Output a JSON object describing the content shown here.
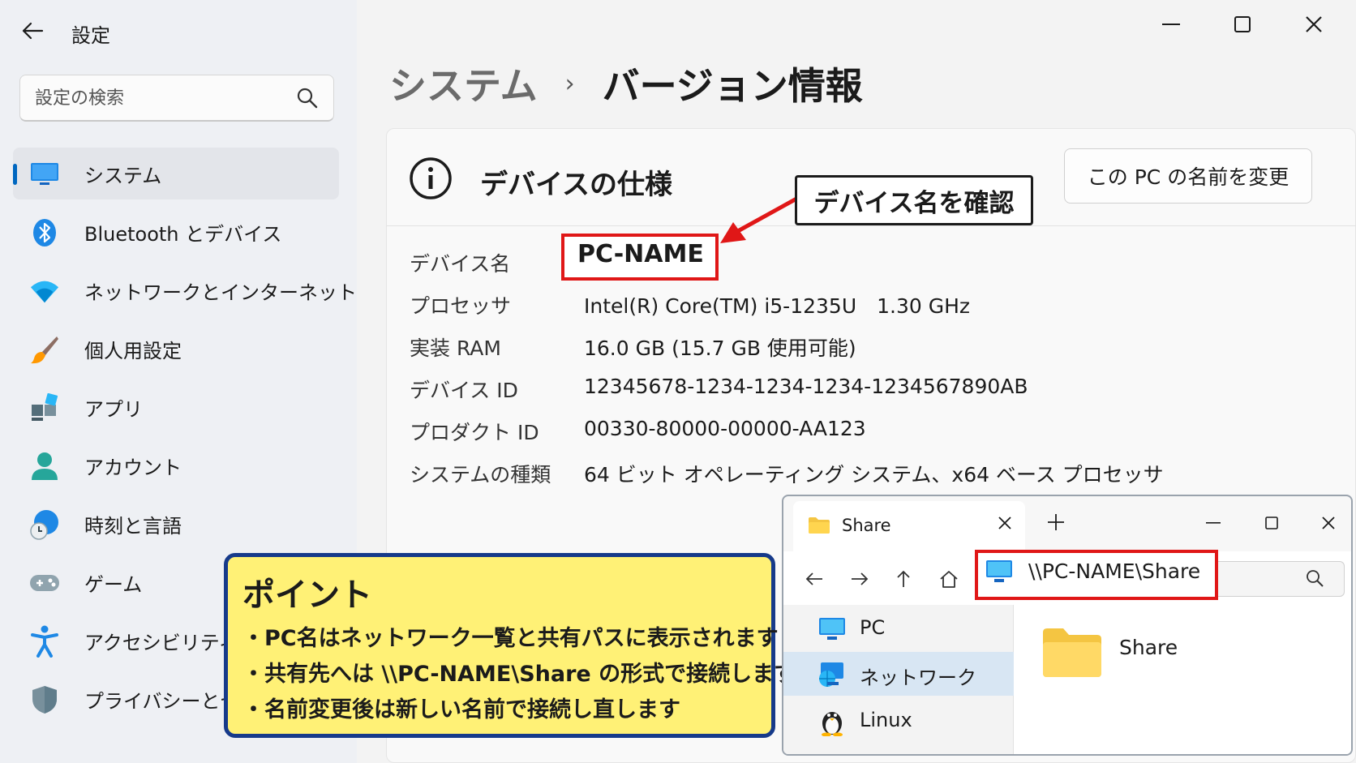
{
  "app": {
    "title": "設定"
  },
  "search": {
    "placeholder": "設定の検索"
  },
  "sidebar": {
    "items": [
      {
        "label": "システム",
        "icon": "monitor-icon",
        "selected": true
      },
      {
        "label": "Bluetooth とデバイス",
        "icon": "bluetooth-icon"
      },
      {
        "label": "ネットワークとインターネット",
        "icon": "wifi-icon"
      },
      {
        "label": "個人用設定",
        "icon": "paintbrush-icon"
      },
      {
        "label": "アプリ",
        "icon": "apps-icon"
      },
      {
        "label": "アカウント",
        "icon": "person-icon"
      },
      {
        "label": "時刻と言語",
        "icon": "globe-clock-icon"
      },
      {
        "label": "ゲーム",
        "icon": "gamepad-icon"
      },
      {
        "label": "アクセシビリティ",
        "icon": "accessibility-icon"
      },
      {
        "label": "プライバシーとセキ",
        "icon": "shield-icon"
      }
    ]
  },
  "breadcrumb": {
    "parent": "システム",
    "separator": "›",
    "current": "バージョン情報"
  },
  "device_spec": {
    "title": "デバイスの仕様",
    "rename_button": "この PC の名前を変更",
    "rows": [
      {
        "label": "デバイス名",
        "value": "PC-NAME"
      },
      {
        "label": "プロセッサ",
        "value": "Intel(R) Core(TM) i5-1235U　1.30 GHz"
      },
      {
        "label": "実装 RAM",
        "value": "16.0 GB (15.7 GB 使用可能)"
      },
      {
        "label": "デバイス ID",
        "value": "12345678-1234-1234-1234-1234567890AB"
      },
      {
        "label": "プロダクト ID",
        "value": "00330-80000-00000-AA123"
      },
      {
        "label": "システムの種類",
        "value": "64 ビット オペレーティング システム、x64 ベース プロセッサ"
      }
    ]
  },
  "annotation": {
    "callout": "デバイス名を確認"
  },
  "point": {
    "title": "ポイント",
    "items": [
      "・PC名はネットワーク一覧と共有パスに表示されます",
      "・共有先へは \\\\PC-NAME\\Share の形式で接続します",
      "・名前変更後は新しい名前で接続し直します"
    ]
  },
  "explorer": {
    "tab_title": "Share",
    "address": "\\\\PC-NAME\\Share",
    "sidebar": [
      {
        "label": "PC",
        "icon": "pc-icon"
      },
      {
        "label": "ネットワーク",
        "icon": "network-icon",
        "selected": true
      },
      {
        "label": "Linux",
        "icon": "linux-penguin-icon"
      }
    ],
    "content": [
      {
        "label": "Share",
        "icon": "folder-icon"
      }
    ]
  },
  "colors": {
    "accent": "#0067c0",
    "highlight": "#e01717",
    "point_bg": "#fff176",
    "point_border": "#163a8a"
  }
}
